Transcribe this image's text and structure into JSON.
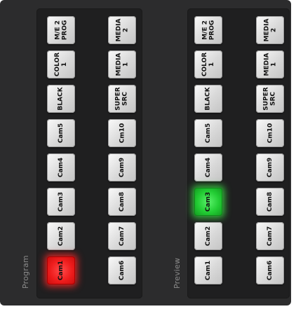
{
  "program": {
    "label": "Program",
    "buttons": {
      "mre2": [
        "M/E 2",
        "PROG"
      ],
      "media2": [
        "MEDIA",
        "2"
      ],
      "color1": [
        "COLOR",
        "1"
      ],
      "media1": [
        "MEDIA",
        "1"
      ],
      "black": [
        "BLACK"
      ],
      "supersrc": [
        "SUPER",
        "SRC"
      ],
      "cam5": [
        "Cam5"
      ],
      "cm10": [
        "Cm10"
      ],
      "cam4": [
        "Cam4"
      ],
      "cam9": [
        "Cam9"
      ],
      "cam3": [
        "Cam3"
      ],
      "cam8": [
        "Cam8"
      ],
      "cam2": [
        "Cam2"
      ],
      "cam7": [
        "Cam7"
      ],
      "cam1": [
        "Cam1"
      ],
      "cam6": [
        "Cam6"
      ]
    },
    "active": "cam1",
    "active_color": "#ee1c1c"
  },
  "preview": {
    "label": "Preview",
    "buttons": {
      "mre2": [
        "M/E 2",
        "PROG"
      ],
      "media2": [
        "MEDIA",
        "2"
      ],
      "color1": [
        "COLOR",
        "1"
      ],
      "media1": [
        "MEDIA",
        "1"
      ],
      "black": [
        "BLACK"
      ],
      "supersrc": [
        "SUPER",
        "SRC"
      ],
      "cam5": [
        "Cam5"
      ],
      "cm10": [
        "Cm10"
      ],
      "cam4": [
        "Cam4"
      ],
      "cam9": [
        "Cam9"
      ],
      "cam3": [
        "Cam3"
      ],
      "cam8": [
        "Cam8"
      ],
      "cam2": [
        "Cam2"
      ],
      "cam7": [
        "Cam7"
      ],
      "cam1": [
        "Cam1"
      ],
      "cam6": [
        "Cam6"
      ]
    },
    "active": "cam3",
    "active_color": "#22cc33"
  }
}
